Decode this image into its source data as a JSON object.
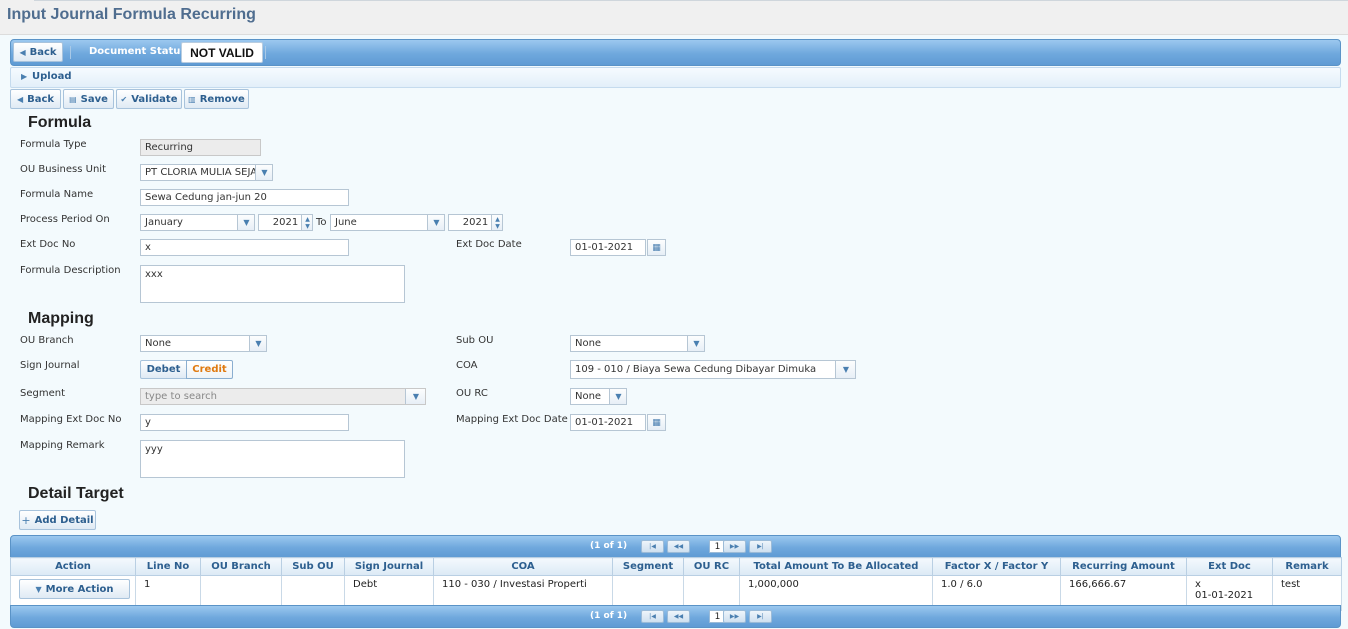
{
  "page": {
    "title": "Input Journal Formula Recurring"
  },
  "toolbar_top": {
    "back_label": "Back",
    "status_label": "Document Status:",
    "status_value": "NOT VALID"
  },
  "upload": {
    "label": "Upload"
  },
  "actions": {
    "back": "Back",
    "save": "Save",
    "validate": "Validate",
    "remove": "Remove"
  },
  "formula": {
    "title": "Formula",
    "type_label": "Formula Type",
    "type_value": "Recurring",
    "bu_label": "OU Business Unit",
    "bu_value": "PT CLORIA MULIA SEJATI",
    "name_label": "Formula Name",
    "name_value": "Sewa Cedung jan-jun 20",
    "period_label": "Process Period On",
    "period_from_month": "January",
    "period_from_year": "2021",
    "period_to_label": "To",
    "period_to_month": "June",
    "period_to_year": "2021",
    "ext_doc_no_label": "Ext Doc No",
    "ext_doc_no_value": "x",
    "ext_doc_date_label": "Ext Doc Date",
    "ext_doc_date_value": "01-01-2021",
    "desc_label": "Formula Description",
    "desc_value": "xxx"
  },
  "mapping": {
    "title": "Mapping",
    "branch_label": "OU Branch",
    "branch_value": "None",
    "sub_ou_label": "Sub OU",
    "sub_ou_value": "None",
    "sign_label": "Sign Journal",
    "sign_debet": "Debet",
    "sign_credit": "Credit",
    "coa_label": "COA",
    "coa_value": "109 - 010 / Biaya Sewa Cedung Dibayar Dimuka",
    "segment_label": "Segment",
    "segment_placeholder": "type to search",
    "ou_rc_label": "OU RC",
    "ou_rc_value": "None",
    "ext_doc_no_label": "Mapping Ext Doc No",
    "ext_doc_no_value": "y",
    "ext_doc_date_label": "Mapping Ext Doc Date",
    "ext_doc_date_value": "01-01-2021",
    "remark_label": "Mapping Remark",
    "remark_value": "yyy"
  },
  "detail": {
    "title": "Detail Target",
    "add_label": "Add Detail",
    "pager_text": "(1 of 1)",
    "page_number": "1",
    "columns": [
      "Action",
      "Line No",
      "OU Branch",
      "Sub OU",
      "Sign Journal",
      "COA",
      "Segment",
      "OU RC",
      "Total Amount To Be Allocated",
      "Factor X / Factor Y",
      "Recurring Amount",
      "Ext Doc",
      "Remark"
    ],
    "rows": [
      {
        "action": "More Action",
        "line_no": "1",
        "ou_branch": "",
        "sub_ou": "",
        "sign": "Debt",
        "coa": "110 - 030 / Investasi Properti",
        "segment": "",
        "ou_rc": "",
        "total": "1,000,000",
        "factor": "1.0 / 6.0",
        "recurring": "166,666.67",
        "ext_doc_no": "x",
        "ext_doc_date": "01-01-2021",
        "remark": "test"
      }
    ]
  },
  "colors": {
    "accent": "#5f9bd4",
    "title": "#4f6d8f",
    "link": "#2d5f8f",
    "active_toggle": "#e07a10"
  }
}
